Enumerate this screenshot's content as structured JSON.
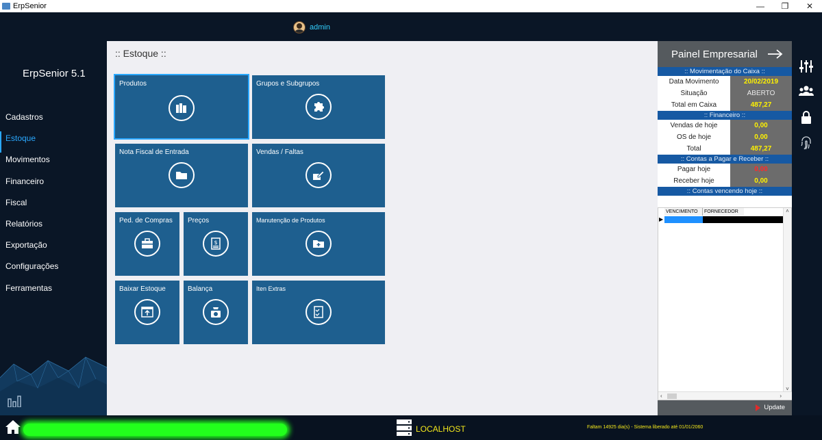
{
  "window": {
    "title": "ErpSenior",
    "controls": [
      "—",
      "❐",
      "✕"
    ]
  },
  "header": {
    "user_name": "admin"
  },
  "sidebar": {
    "brand": "ErpSenior 5.1",
    "items": [
      {
        "label": "Cadastros"
      },
      {
        "label": "Estoque",
        "active": true
      },
      {
        "label": "Movimentos"
      },
      {
        "label": "Financeiro"
      },
      {
        "label": "Fiscal"
      },
      {
        "label": "Relatórios"
      },
      {
        "label": "Exportação"
      },
      {
        "label": "Configurações"
      },
      {
        "label": "Ferramentas"
      }
    ]
  },
  "main": {
    "title": ":: Estoque ::",
    "tiles": [
      {
        "label": "Produtos",
        "icon": "books-icon"
      },
      {
        "label": "Grupos e Subgrupos",
        "icon": "puzzle-icon"
      },
      {
        "label": "Nota Fiscal de Entrada",
        "icon": "folder-icon"
      },
      {
        "label": "Vendas / Faltas",
        "icon": "edit-icon"
      },
      {
        "label": "Ped. de Compras",
        "icon": "briefcase-icon"
      },
      {
        "label": "Preços",
        "icon": "price-doc-icon"
      },
      {
        "label": "Manutenção de Produtos",
        "icon": "folder-plus-icon"
      },
      {
        "label": "Baixar Estoque",
        "icon": "download-window-icon"
      },
      {
        "label": "Balança",
        "icon": "scale-icon"
      },
      {
        "label": "Iten Extras",
        "icon": "checklist-icon"
      }
    ]
  },
  "panel": {
    "title": "Painel Empresarial",
    "caixa": {
      "section": ":: Movimentação do Caixa ::",
      "rows": [
        {
          "k": "Data Movimento",
          "v": "20/02/2019"
        },
        {
          "k": "Situação",
          "v": "ABERTO"
        },
        {
          "k": "Total em Caixa",
          "v": "487,27"
        }
      ]
    },
    "financeiro": {
      "section": ":: Financeiro ::",
      "rows": [
        {
          "k": "Vendas de hoje",
          "v": "0,00"
        },
        {
          "k": "OS de hoje",
          "v": "0,00"
        },
        {
          "k": "Total",
          "v": "487,27"
        }
      ]
    },
    "contas": {
      "section": ":: Contas a Pagar e Receber ::",
      "rows": [
        {
          "k": "Pagar hoje",
          "v": "0,00"
        },
        {
          "k": "Receber hoje",
          "v": "0,00"
        }
      ]
    },
    "vencendo": {
      "section": ":: Contas vencendo hoje ::",
      "columns": [
        "VENCIMENTO",
        "FORNECEDOR"
      ]
    },
    "update_label": "Update"
  },
  "footer": {
    "server": "LOCALHOST",
    "license": "Faltam 14925 dia(s) - Sistema liberado até 01/01/2060"
  }
}
